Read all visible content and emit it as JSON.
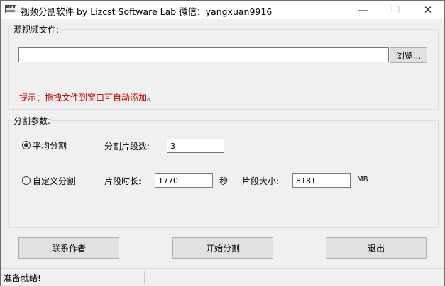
{
  "window": {
    "title": "视频分割软件  by Lizcst Software Lab  微信：yangxuan9916",
    "minimize_glyph": "—",
    "maximize_glyph": "☐",
    "close_glyph": "✕"
  },
  "source_group": {
    "title": "源视频文件:",
    "path_value": "",
    "browse_label": "浏览...",
    "hint": "提示：拖拽文件到窗口可自动添加。"
  },
  "split_group": {
    "title": "分割参数:",
    "even_mode": {
      "label": "平均分割",
      "checked": true,
      "segment_count_label": "分割片段数:",
      "segment_count_value": "3"
    },
    "custom_mode": {
      "label": "自定义分割",
      "checked": false,
      "duration_label": "片段时长:",
      "duration_value": "1770",
      "duration_unit": "秒",
      "size_label": "片段大小:",
      "size_value": "8181",
      "size_unit": "MB"
    }
  },
  "buttons": {
    "contact": "联系作者",
    "start": "开始分割",
    "exit": "退出"
  },
  "status": {
    "text": "准备就绪!"
  },
  "icons": {
    "app": "film-reel-icon"
  }
}
